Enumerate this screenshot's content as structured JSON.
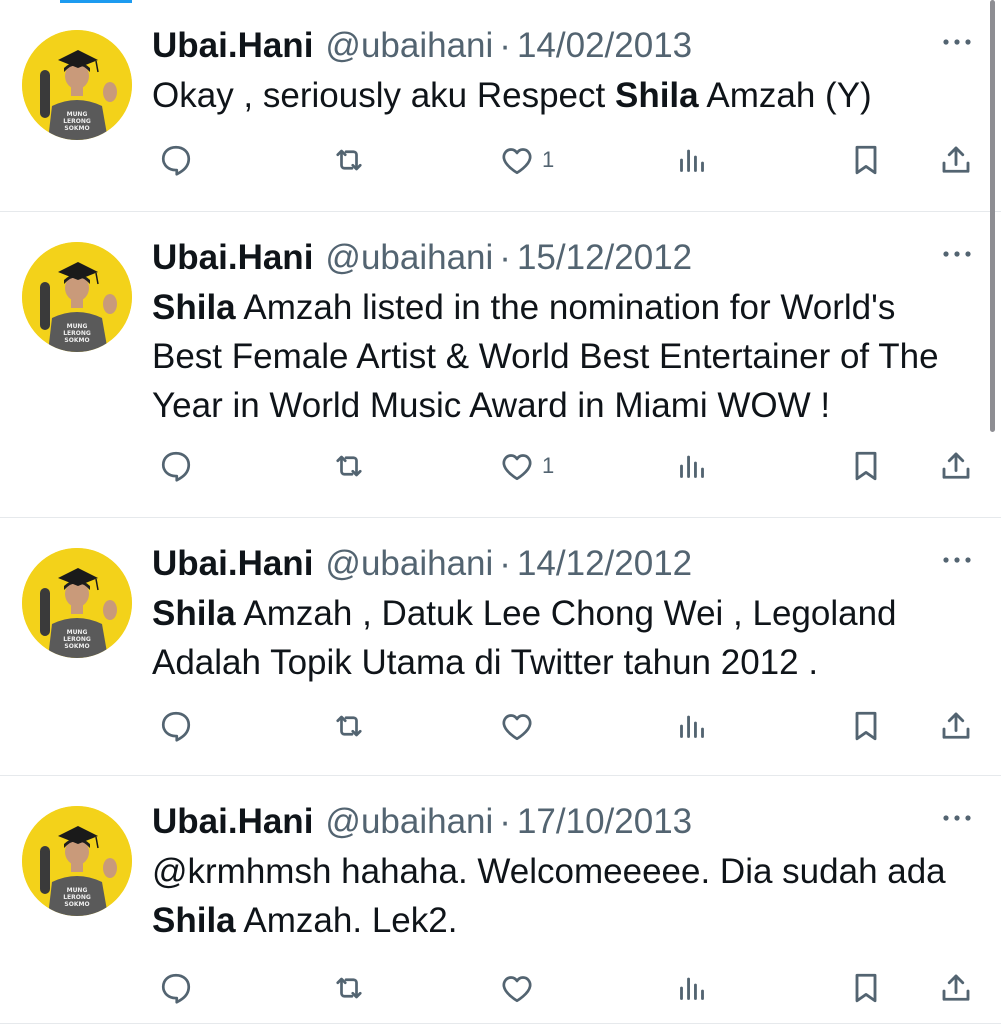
{
  "tweets": [
    {
      "display_name": "Ubai.Hani",
      "handle": "@ubaihani",
      "separator": "·",
      "date": "14/02/2013",
      "text_parts": [
        {
          "text": "Okay , seriously aku Respect ",
          "bold": false
        },
        {
          "text": "Shila",
          "bold": true
        },
        {
          "text": " Amzah (Y)",
          "bold": false
        }
      ],
      "like_count": "1"
    },
    {
      "display_name": "Ubai.Hani",
      "handle": "@ubaihani",
      "separator": "·",
      "date": "15/12/2012",
      "text_parts": [
        {
          "text": "Shila",
          "bold": true
        },
        {
          "text": " Amzah listed in the nomination for World's Best Female Artist & World Best Entertainer of The Year in World Music Award in Miami WOW !",
          "bold": false
        }
      ],
      "like_count": "1"
    },
    {
      "display_name": "Ubai.Hani",
      "handle": "@ubaihani",
      "separator": "·",
      "date": "14/12/2012",
      "text_parts": [
        {
          "text": "Shila",
          "bold": true
        },
        {
          "text": " Amzah , Datuk Lee Chong Wei , Legoland Adalah Topik Utama di Twitter tahun 2012 .",
          "bold": false
        }
      ],
      "like_count": ""
    },
    {
      "display_name": "Ubai.Hani",
      "handle": "@ubaihani",
      "separator": "·",
      "date": "17/10/2013",
      "text_parts": [
        {
          "text": "@krmhmsh hahaha. Welcomeeeee. Dia sudah ada ",
          "bold": false
        },
        {
          "text": "Shila",
          "bold": true
        },
        {
          "text": " Amzah. Lek2.",
          "bold": false
        }
      ],
      "like_count": ""
    }
  ],
  "icons": {
    "reply": "reply-icon",
    "repost": "repost-icon",
    "like": "like-icon",
    "views": "views-icon",
    "bookmark": "bookmark-icon",
    "share": "share-icon",
    "more": "more-icon",
    "avatar": "avatar"
  },
  "avatar_shirt_text": [
    "MUNG",
    "LERONG",
    "SOKMO"
  ],
  "colors": {
    "text": "#0f1419",
    "secondary": "#536471",
    "avatar_bg": "#f3d21a",
    "divider": "#e6e9ec",
    "accent": "#1d9bf0"
  }
}
